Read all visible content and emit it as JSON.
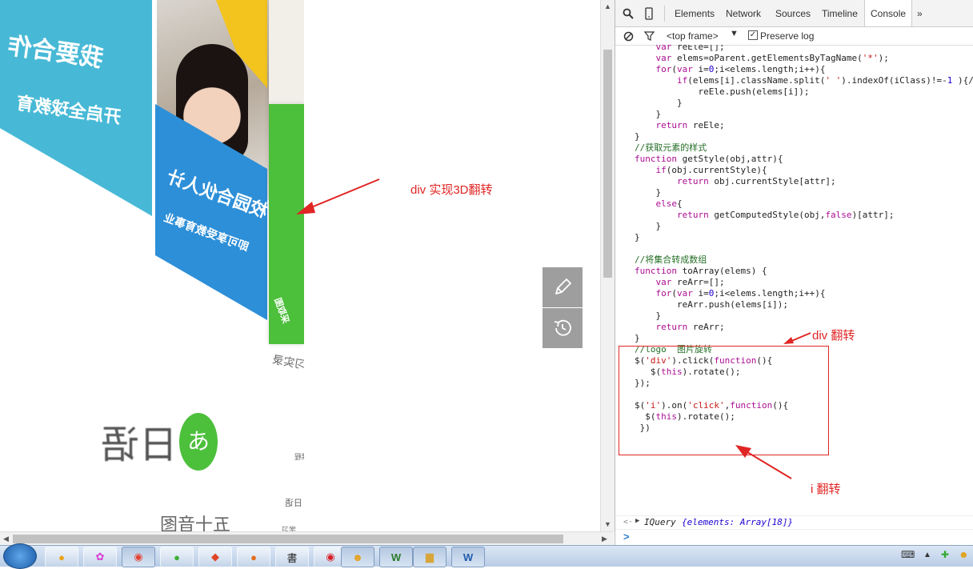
{
  "annotations": {
    "div3d": "div  实现3D翻转",
    "div_flip": "div 翻转",
    "i_flip": "i 翻转"
  },
  "page": {
    "teal_card_text_1": "我要合作",
    "teal_card_text_2": "开启全球教育",
    "blue_card_text_1": "校园合伙人计",
    "blue_card_text_2": "即可享受教育事业",
    "green_card_text": "采取图",
    "caption_under_cards": "取得学习实录",
    "riyu_label": "日语",
    "riyu_logo_char": "あ",
    "bottom_text": "五十音图",
    "side_text_1": "课程",
    "side_text_2": "日语",
    "side_text_3": "学习"
  },
  "sidetools": {
    "edit_icon": "pencil-icon",
    "history_icon": "history-icon"
  },
  "devtools": {
    "tabs": [
      "Elements",
      "Network",
      "Sources",
      "Timeline",
      "Console"
    ],
    "active_tab": "Console",
    "more_tabs": "»",
    "frame_select": "<top frame>",
    "preserve_log_label": "Preserve log",
    "preserve_log_checked": true,
    "output": {
      "arrow": "▶",
      "prefix": "IQuery ",
      "detail": "{elements: Array[18]}"
    },
    "prompt": ">"
  },
  "taskbar": {
    "apps": [
      "start-orb",
      "app-1",
      "app-2",
      "chrome",
      "wechat",
      "git",
      "firefox",
      "app-book",
      "netease-music",
      "qq",
      "wps",
      "file-explorer",
      "word"
    ]
  },
  "colors": {
    "annotation_red": "#e02525",
    "teal": "#47b9d6",
    "blue": "#2d8fd8",
    "green": "#4cbf3b",
    "yellow": "#f3c41e"
  }
}
